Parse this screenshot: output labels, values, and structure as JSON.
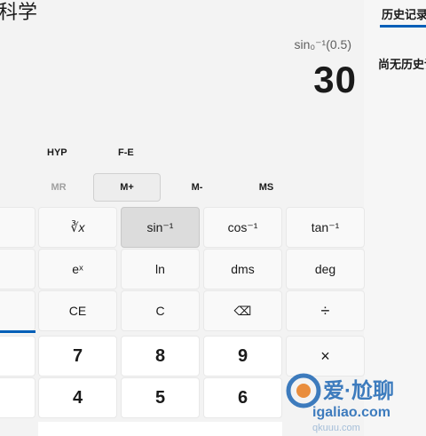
{
  "app": {
    "title": "科学"
  },
  "history": {
    "tab_label": "历史记录",
    "empty_text": "尚无历史记录"
  },
  "display": {
    "expression": "sin₀⁻¹(0.5)",
    "value": "30"
  },
  "modes": {
    "hyp": "HYP",
    "fe": "F-E"
  },
  "memory": {
    "mr": "MR",
    "mplus": "M+",
    "mminus": "M-",
    "ms": "MS"
  },
  "keys": {
    "cuberoot": "∛x",
    "asin": "sin⁻¹",
    "acos": "cos⁻¹",
    "atan": "tan⁻¹",
    "exp": "eˣ",
    "ln": "ln",
    "dms": "dms",
    "deg": "deg",
    "ce": "CE",
    "clear": "C",
    "backspace": "⌫",
    "divide": "÷",
    "seven": "7",
    "eight": "8",
    "nine": "9",
    "multiply": "×",
    "four": "4",
    "five": "5",
    "six": "6"
  },
  "watermark": {
    "line1": "爱·尬聊",
    "line2": "igaliao.com",
    "line3": "qkuuu.com"
  }
}
